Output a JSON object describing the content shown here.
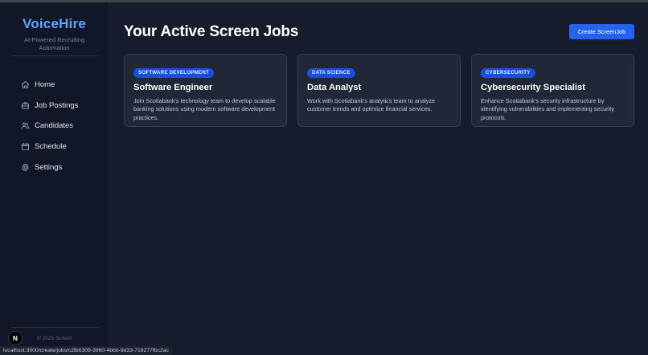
{
  "sidebar": {
    "brand_title": "VoiceHire",
    "brand_subtitle": "AI-Powered Recruiting Automation",
    "items": [
      {
        "label": "Home",
        "icon": "home-icon"
      },
      {
        "label": "Job Postings",
        "icon": "briefcase-icon"
      },
      {
        "label": "Candidates",
        "icon": "users-icon"
      },
      {
        "label": "Schedule",
        "icon": "calendar-icon"
      },
      {
        "label": "Settings",
        "icon": "gear-icon"
      }
    ],
    "footer": "© 2025 ScoutX"
  },
  "main": {
    "title": "Your Active Screen Jobs",
    "create_button": "Create ScreenJob",
    "jobs": [
      {
        "category": "SOFTWARE DEVELOPMENT",
        "title": "Software Engineer",
        "description": "Join Scotiabank's technology team to develop scalable banking solutions using modern software development practices."
      },
      {
        "category": "DATA SCIENCE",
        "title": "Data Analyst",
        "description": "Work with Scotiabank's analytics team to analyze customer trends and optimize financial services."
      },
      {
        "category": "CYBERSECURITY",
        "title": "Cybersecurity Specialist",
        "description": "Enhance Scotiabank's security infrastructure by identifying vulnerabilities and implementing security protocols."
      }
    ]
  },
  "status_bar": {
    "url": "localhost:3000/create/jobs/c2fb6309-3960-4bbb-9d33-718277fbc2ac"
  },
  "dev_badge": "N",
  "colors": {
    "accent": "#2563eb",
    "brand": "#60a5fa",
    "background": "#161c2b",
    "sidebar": "#111727",
    "card": "#202838"
  }
}
